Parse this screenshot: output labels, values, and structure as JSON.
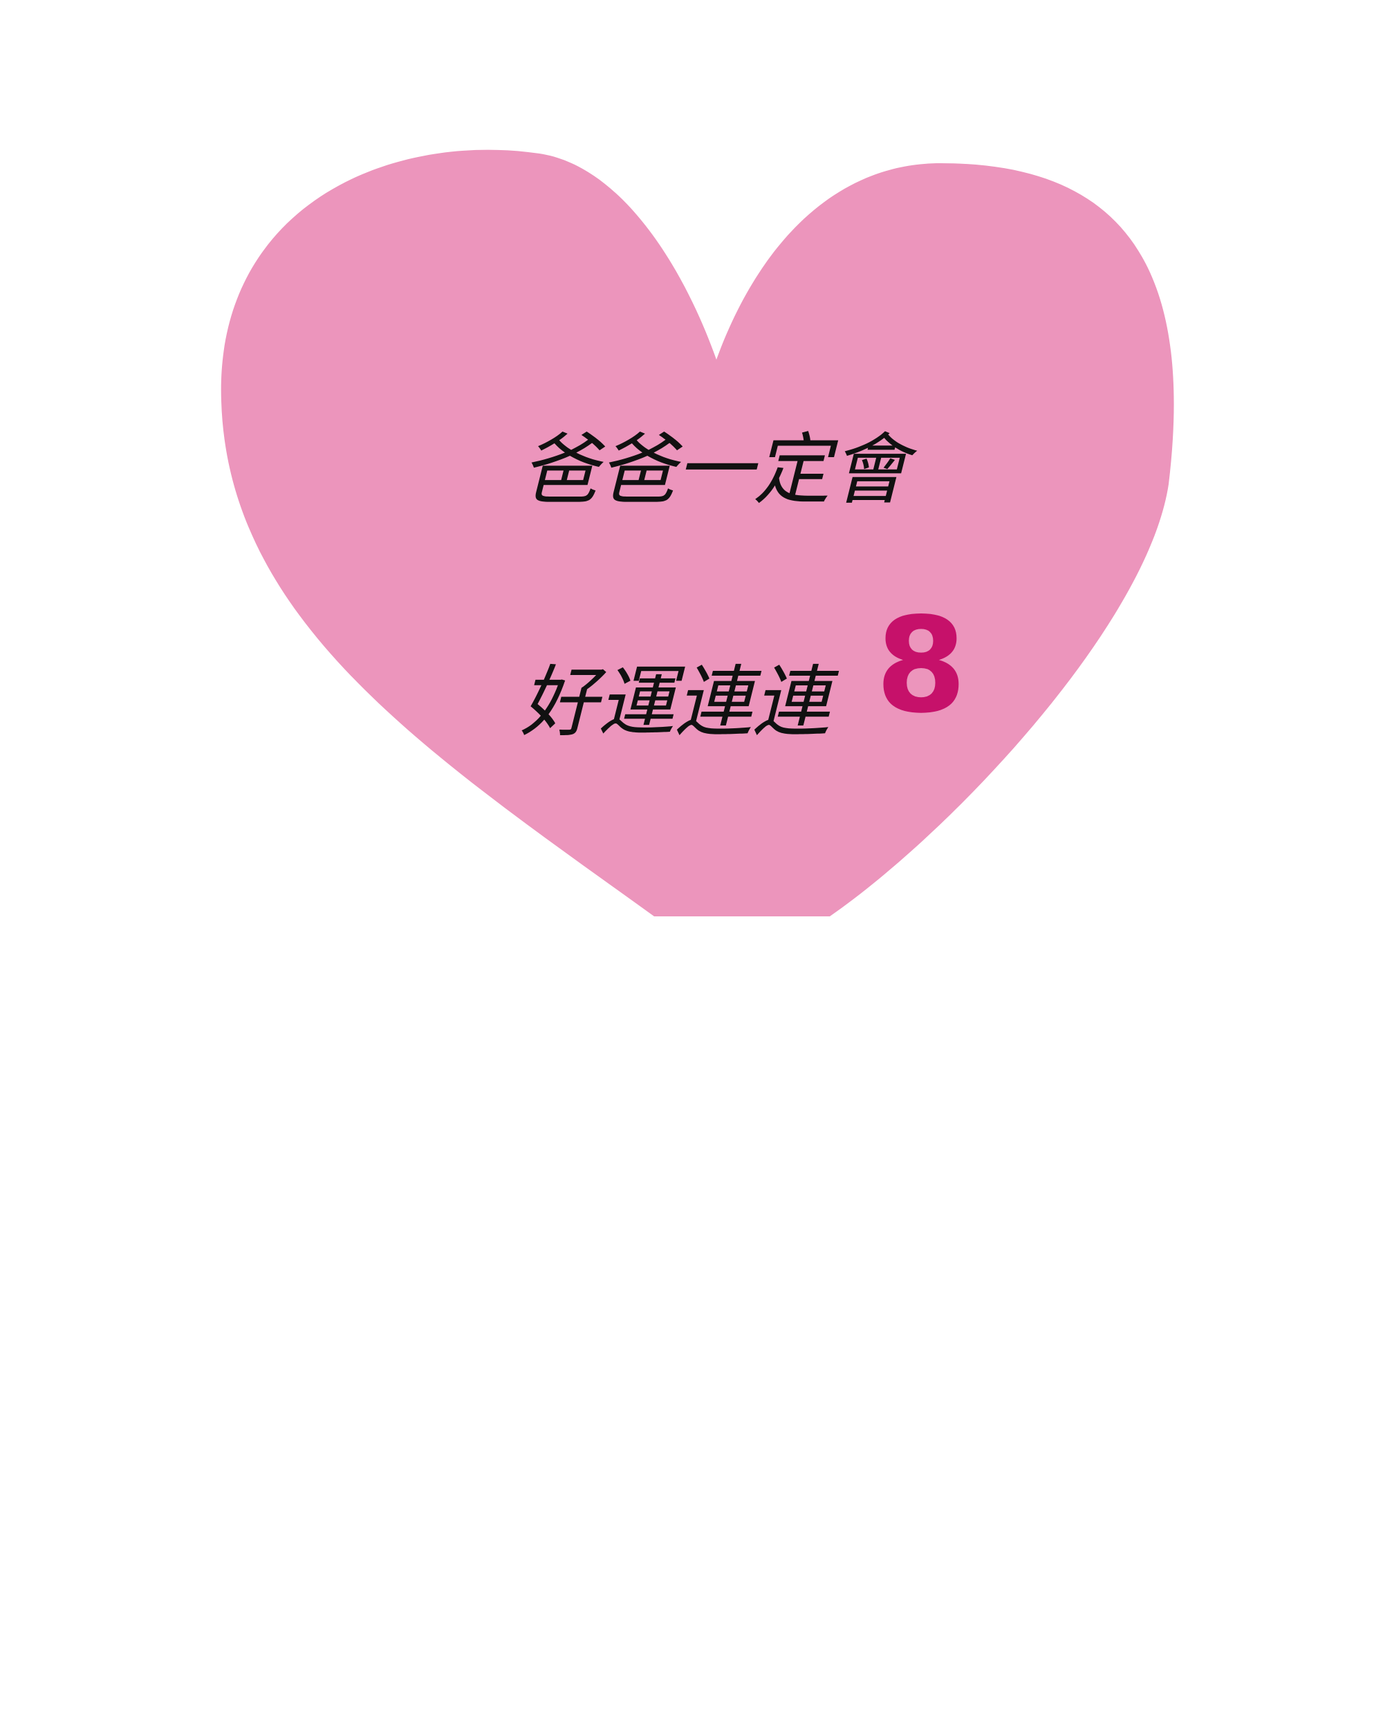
{
  "message": {
    "line1": "爸爸一定會",
    "line2": "好運連連",
    "accent": "8"
  },
  "colors": {
    "background": "#ffffff",
    "heart": "#ec95bc",
    "text": "#111111",
    "accent": "#c6116a"
  },
  "shapes": [
    "heart-shape"
  ]
}
